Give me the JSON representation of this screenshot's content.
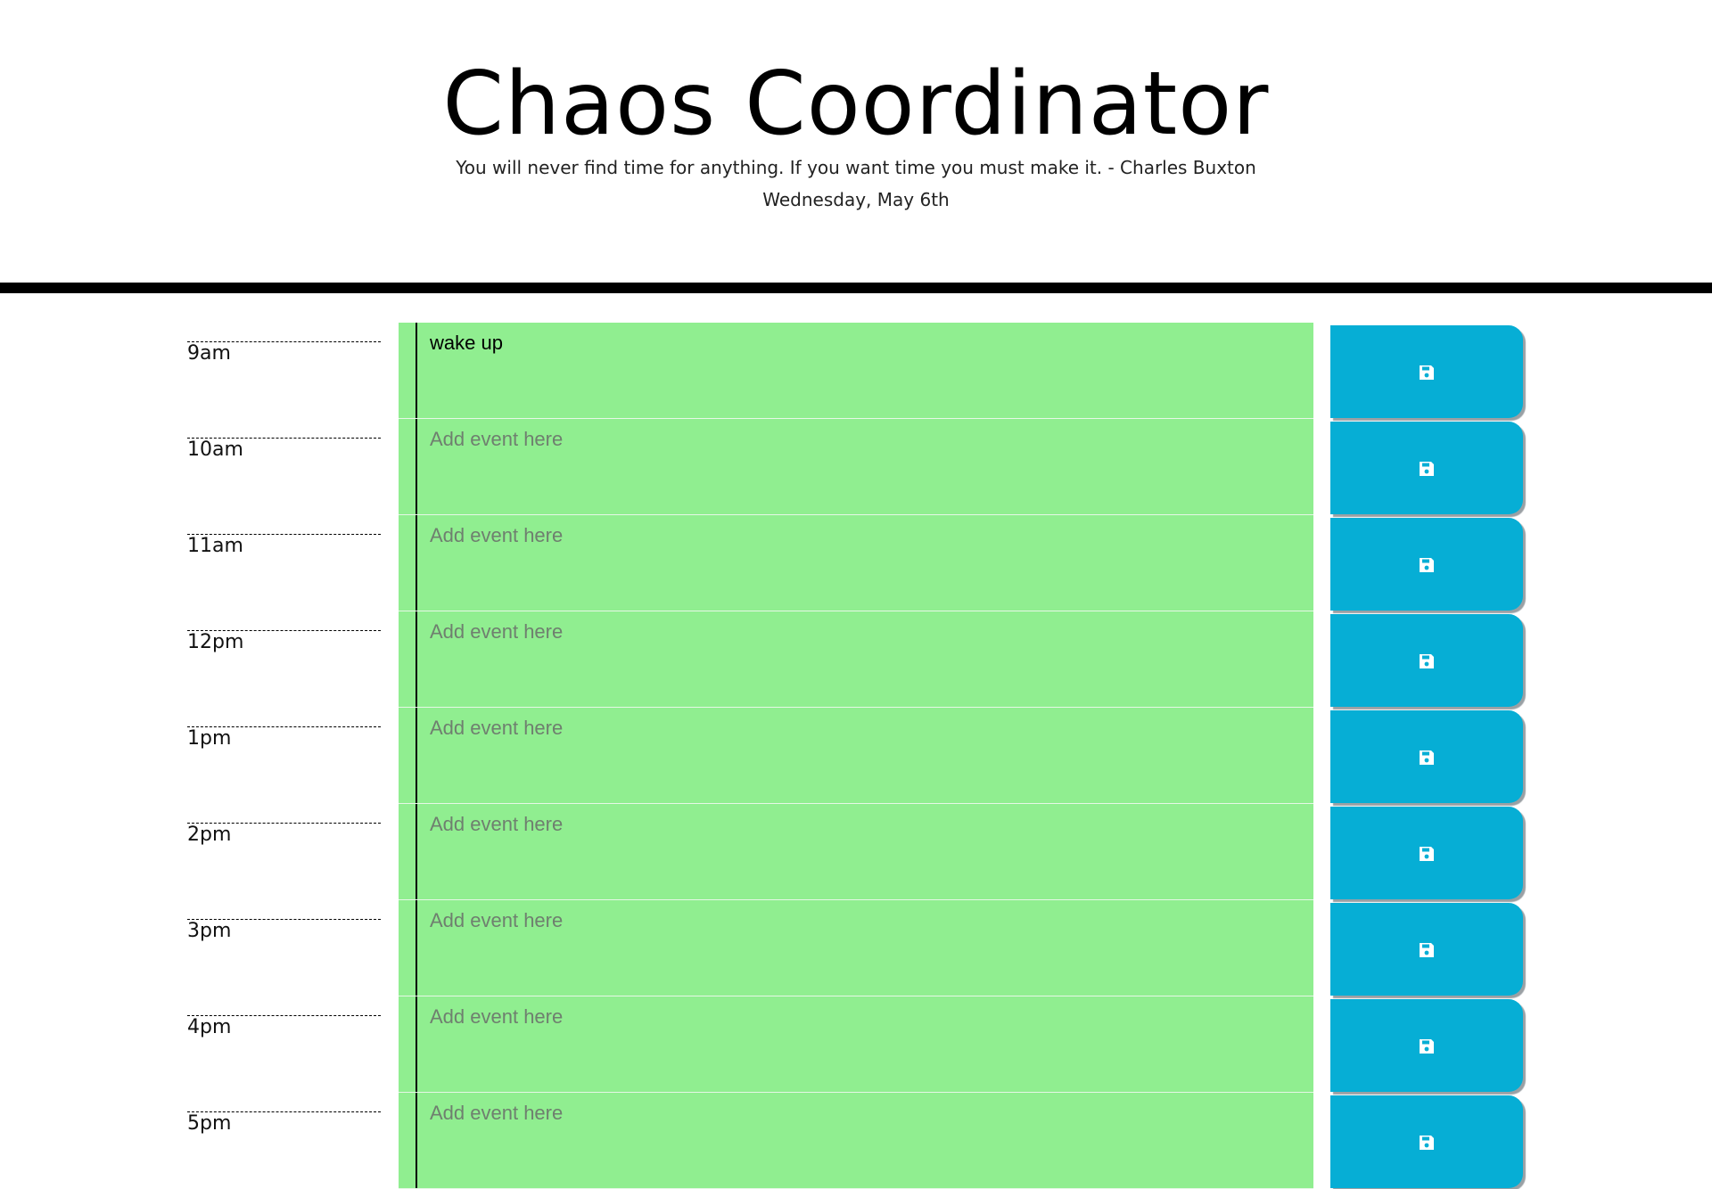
{
  "header": {
    "title": "Chaos Coordinator",
    "quote": "You will never find time for anything. If you want time you must make it. - Charles Buxton",
    "date": "Wednesday, May 6th"
  },
  "colors": {
    "present_slot": "#90ee90",
    "save_button": "#06aed5",
    "divider": "#000000"
  },
  "planner": {
    "save_icon": "floppy-disk-icon",
    "rows": [
      {
        "hour": "9am",
        "value": "wake up",
        "placeholder": "Add event here"
      },
      {
        "hour": "10am",
        "value": "",
        "placeholder": "Add event here"
      },
      {
        "hour": "11am",
        "value": "",
        "placeholder": "Add event here"
      },
      {
        "hour": "12pm",
        "value": "",
        "placeholder": "Add event here"
      },
      {
        "hour": "1pm",
        "value": "",
        "placeholder": "Add event here"
      },
      {
        "hour": "2pm",
        "value": "",
        "placeholder": "Add event here"
      },
      {
        "hour": "3pm",
        "value": "",
        "placeholder": "Add event here"
      },
      {
        "hour": "4pm",
        "value": "",
        "placeholder": "Add event here"
      },
      {
        "hour": "5pm",
        "value": "",
        "placeholder": "Add event here"
      }
    ]
  }
}
